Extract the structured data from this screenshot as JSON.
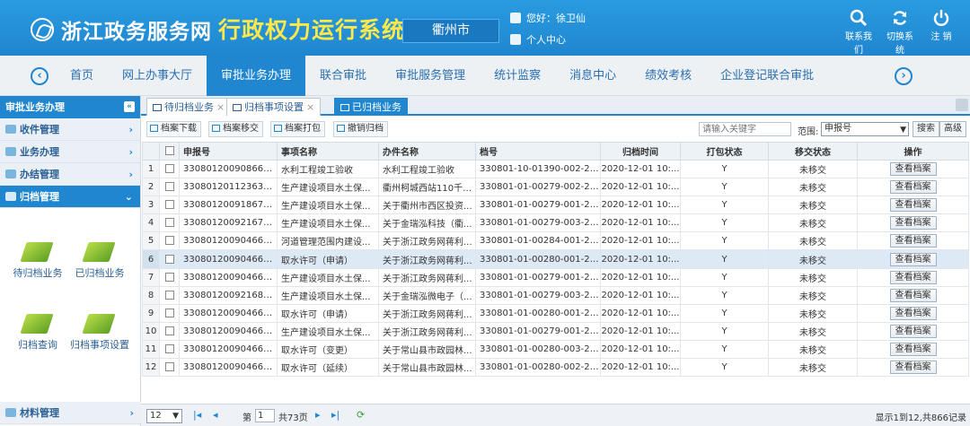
{
  "header": {
    "site_name": "浙江政务服务网",
    "system_name": "行政权力运行系统",
    "city": "衢州市",
    "greeting": "您好：徐卫仙",
    "personal_center": "个人中心",
    "buttons": [
      {
        "label": "联系我们",
        "icon": "search-icon"
      },
      {
        "label": "切换系统",
        "icon": "refresh-icon"
      },
      {
        "label": "注 销",
        "icon": "power-icon"
      }
    ]
  },
  "nav": {
    "items": [
      "首页",
      "网上办事大厅",
      "审批业务办理",
      "联合审批",
      "审批服务管理",
      "统计监察",
      "消息中心",
      "绩效考核",
      "企业登记联合审批"
    ],
    "active_index": 2
  },
  "sidebar": {
    "title": "审批业务办理",
    "groups": [
      "收件管理",
      "业务办理",
      "办结管理",
      "归档管理"
    ],
    "tiles": [
      "待归档业务",
      "已归档业务",
      "归档查询",
      "归档事项设置"
    ],
    "bottom_group": "材料管理"
  },
  "tabs": [
    {
      "label": "待归档业务",
      "closable": true
    },
    {
      "label": "归档事项设置",
      "closable": true
    },
    {
      "label": "已归档业务",
      "closable": false,
      "active": true
    }
  ],
  "toolbar": {
    "buttons": [
      "档案下载",
      "档案移交",
      "档案打包",
      "撤销归档"
    ],
    "search_placeholder": "请输入关键字",
    "scope_label": "范围:",
    "scope_value": "申报号",
    "search_button": "搜索",
    "advanced_button": "高级"
  },
  "table": {
    "columns": [
      "申报号",
      "事项名称",
      "办件名称",
      "档号",
      "归档时间",
      "打包状态",
      "移交状态",
      "操作"
    ],
    "highlighted_row": 6,
    "action_label": "查看档案",
    "rows": [
      {
        "n": "1",
        "sbh": "3308012009086671...",
        "sx": "水利工程竣工验收",
        "bj": "水利工程竣工验收",
        "dh": "330801-10-01390-002-202...",
        "sj": "2020-12-01 10:...",
        "db": "Y",
        "yj": "未移交"
      },
      {
        "n": "2",
        "sbh": "3308012011236322...",
        "sx": "生产建设项目水土保...",
        "bj": "衢州柯城西站110千伏...",
        "dh": "330801-01-00279-002-202...",
        "sj": "2020-12-01 10:...",
        "db": "Y",
        "yj": "未移交"
      },
      {
        "n": "3",
        "sbh": "3308012009186781...",
        "sx": "生产建设项目水土保...",
        "bj": "关于衢州市西区投资...",
        "dh": "330801-01-00279-001-202...",
        "sj": "2020-12-01 10:...",
        "db": "Y",
        "yj": "未移交"
      },
      {
        "n": "4",
        "sbh": "3308012009216798...",
        "sx": "生产建设项目水土保...",
        "bj": "关于金瑞泓科技（衢...",
        "dh": "330801-01-00279-003-202...",
        "sj": "2020-12-01 10:...",
        "db": "Y",
        "yj": "未移交"
      },
      {
        "n": "5",
        "sbh": "3308012009046639...",
        "sx": "河道管理范围内建设...",
        "bj": "关于浙江政务网蒋利...",
        "dh": "330801-01-00284-001-202...",
        "sj": "2020-12-01 10:...",
        "db": "Y",
        "yj": "未移交"
      },
      {
        "n": "6",
        "sbh": "3308012009046638...",
        "sx": "取水许可（申请）",
        "bj": "关于浙江政务网蒋利...",
        "dh": "330801-01-00280-001-202...",
        "sj": "2020-12-01 10:...",
        "db": "Y",
        "yj": "未移交"
      },
      {
        "n": "7",
        "sbh": "3308012009046639...",
        "sx": "生产建设项目水土保...",
        "bj": "关于浙江政务网蒋利...",
        "dh": "330801-01-00279-001-202...",
        "sj": "2020-12-01 10:...",
        "db": "Y",
        "yj": "未移交"
      },
      {
        "n": "8",
        "sbh": "3308012009216800...",
        "sx": "生产建设项目水土保...",
        "bj": "关于金瑞泓微电子（...",
        "dh": "330801-01-00279-003-202...",
        "sj": "2020-12-01 10:...",
        "db": "Y",
        "yj": "未移交"
      },
      {
        "n": "9",
        "sbh": "3308012009046641...",
        "sx": "取水许可（申请）",
        "bj": "关于浙江政务网蒋利...",
        "dh": "330801-01-00280-001-202...",
        "sj": "2020-12-01 10:...",
        "db": "Y",
        "yj": "未移交"
      },
      {
        "n": "10",
        "sbh": "3308012009046641...",
        "sx": "生产建设项目水土保...",
        "bj": "关于浙江政务网蒋利...",
        "dh": "330801-01-00279-001-202...",
        "sj": "2020-12-01 10:...",
        "db": "Y",
        "yj": "未移交"
      },
      {
        "n": "11",
        "sbh": "3308012009046638...",
        "sx": "取水许可（变更）",
        "bj": "关于常山县市政园林...",
        "dh": "330801-01-00280-003-202...",
        "sj": "2020-12-01 10:...",
        "db": "Y",
        "yj": "未移交"
      },
      {
        "n": "12",
        "sbh": "3308012009046637...",
        "sx": "取水许可（延续）",
        "bj": "关于常山县市政园林...",
        "dh": "330801-01-00280-002-202...",
        "sj": "2020-12-01 10:...",
        "db": "Y",
        "yj": "未移交"
      }
    ]
  },
  "pager": {
    "page_size": "12",
    "page_label": "第",
    "page_value": "1",
    "total_pages": "共73页",
    "info": "显示1到12,共866记录"
  },
  "colors": {
    "brand_blue": "#1f86cf",
    "title_yellow": "#ffe94a",
    "highlight_row": "#dde9f5"
  }
}
